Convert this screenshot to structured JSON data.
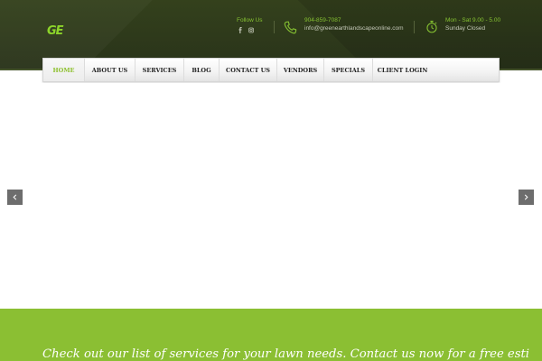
{
  "header": {
    "logo_text": "GE",
    "follow": {
      "label": "Follow Us",
      "icons": [
        "facebook-icon",
        "instagram-icon"
      ]
    },
    "contact": {
      "icon": "phone-icon",
      "phone": "904-859-7087",
      "email": "info@greenearthlandscapeonline.com"
    },
    "hours": {
      "icon": "stopwatch-icon",
      "main": "Mon - Sat 9.00 - 5.00",
      "sub": "Sunday Closed"
    }
  },
  "nav": {
    "items": [
      {
        "label": "Home",
        "active": true
      },
      {
        "label": "About Us"
      },
      {
        "label": "Services"
      },
      {
        "label": "Blog"
      },
      {
        "label": "Contact Us"
      },
      {
        "label": "Vendors"
      },
      {
        "label": "Specials"
      },
      {
        "label": "Client Login"
      }
    ]
  },
  "slider": {
    "prev_icon": "chevron-left-icon",
    "next_icon": "chevron-right-icon"
  },
  "banner": {
    "text": "Check out our list of services for your lawn needs. Contact us now for a free estimate."
  },
  "colors": {
    "header_bg": "#2f3a19",
    "accent_green": "#8bbf33",
    "nav_active": "#8cbf2b",
    "arrow_bg": "#6d6d6d"
  }
}
